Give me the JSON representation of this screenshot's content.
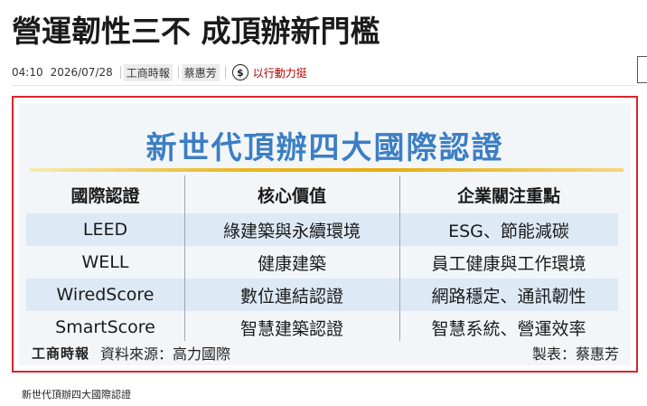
{
  "article": {
    "headline": "營運韌性三不 成頂辦新門檻",
    "time": "04:10",
    "date": "2026/07/28",
    "source_tag": "工商時報",
    "author_tag": "蔡惠芳",
    "donate_icon": "dollar-coin-icon",
    "donate_symbol": "$",
    "donate_label": "以行動力挺"
  },
  "figure": {
    "title": "新世代頂辦四大國際認證",
    "columns": [
      "國際認證",
      "核心價值",
      "企業關注重點"
    ],
    "rows": [
      [
        "LEED",
        "綠建築與永續環境",
        "ESG、節能減碳"
      ],
      [
        "WELL",
        "健康建築",
        "員工健康與工作環境"
      ],
      [
        "WiredScore",
        "數位連結認證",
        "網路穩定、通訊韌性"
      ],
      [
        "SmartScore",
        "智慧建築認證",
        "智慧系統、營運效率"
      ]
    ],
    "footer_logo": "工商時報",
    "footer_source": "資料來源：高力國際",
    "footer_maker": "製表：蔡惠芳",
    "accent_color": "#3b7ec4",
    "border_color": "#d9252c",
    "band_color": "#dde9f4"
  },
  "caption": "新世代頂辦四大國際認證"
}
